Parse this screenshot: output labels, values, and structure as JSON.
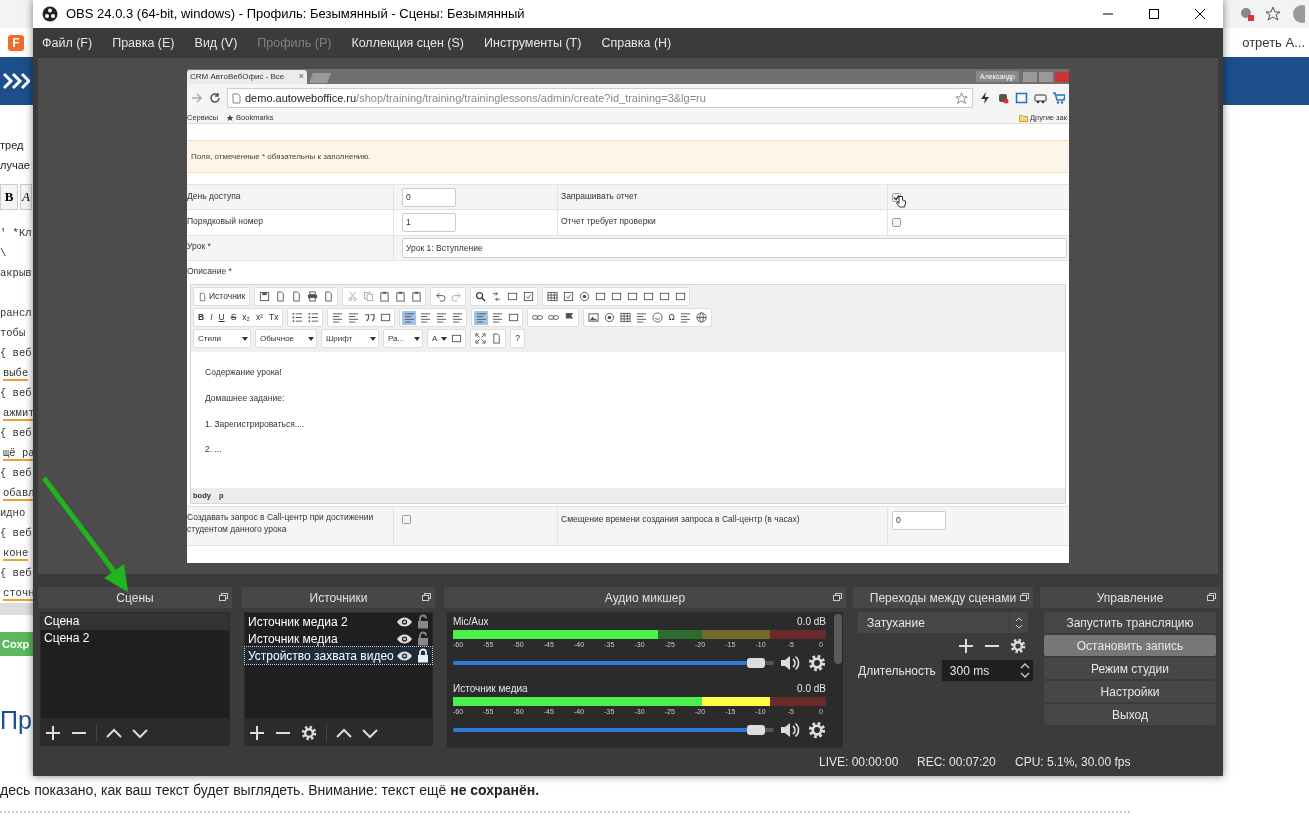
{
  "background_page": {
    "favicon_letter": "F",
    "bookmark_text": "отреть А...",
    "left_lines": [
      {
        "kind": "text",
        "text": "тред"
      },
      {
        "kind": "text",
        "text": "лучае"
      },
      {
        "kind": "toolbar",
        "buttons": [
          "B",
          "A"
        ]
      },
      {
        "kind": "code",
        "text": "' *Кл",
        "underlined": false
      },
      {
        "kind": "code",
        "text": "\\",
        "underlined": false
      },
      {
        "kind": "code",
        "text": "акрыв",
        "underlined": false
      },
      {
        "kind": "blank"
      },
      {
        "kind": "code",
        "text": "рансл",
        "underlined": false
      },
      {
        "kind": "code",
        "text": "тобы",
        "underlined": false
      },
      {
        "kind": "code",
        "text": "{ веб",
        "underlined": false
      },
      {
        "kind": "code",
        "text": "выбе",
        "underlined": true
      },
      {
        "kind": "code",
        "text": "{ веб",
        "underlined": false
      },
      {
        "kind": "code",
        "text": "ажмит",
        "underlined": true
      },
      {
        "kind": "code",
        "text": "{ веб",
        "underlined": false
      },
      {
        "kind": "code",
        "text": "щё ра",
        "underlined": true
      },
      {
        "kind": "code",
        "text": "{ веб",
        "underlined": false
      },
      {
        "kind": "code",
        "text": "обавл",
        "underlined": true
      },
      {
        "kind": "code",
        "text": "идно",
        "underlined": false
      },
      {
        "kind": "code",
        "text": "{ веб",
        "underlined": false
      },
      {
        "kind": "code",
        "text": "коне",
        "underlined": true
      },
      {
        "kind": "code",
        "text": "{ веб",
        "underlined": false
      },
      {
        "kind": "code",
        "text": "сточн",
        "underlined": true
      }
    ],
    "save_button": "Сохр",
    "heading": "Пр",
    "preview_note": "десь показано, как ваш текст будет выглядеть. Внимание: текст ещё **не сохранён.**"
  },
  "window": {
    "title": "OBS 24.0.3 (64-bit, windows) - Профиль: Безымянный - Сцены: Безымянный"
  },
  "menu": [
    {
      "label": "Файл (F)",
      "disabled": false
    },
    {
      "label": "Правка (E)",
      "disabled": false
    },
    {
      "label": "Вид (V)",
      "disabled": false
    },
    {
      "label": "Профиль (P)",
      "disabled": true
    },
    {
      "label": "Коллекция сцен (S)",
      "disabled": false
    },
    {
      "label": "Инструменты (T)",
      "disabled": false
    },
    {
      "label": "Справка (H)",
      "disabled": false
    }
  ],
  "captured_browser": {
    "tab_title": "CRM АвтоВебОфис - Все",
    "tab_close": "×",
    "user": "Александр",
    "url_host": "demo.autoweboffice.ru",
    "url_path": "/shop/training/training/traininglessons/admin/create?id_training=3&lg=ru",
    "bookmarks": [
      "Сервисы",
      "Bookmarks"
    ],
    "other_bookmarks": "Другие зак",
    "notice": "Поля, отмеченные * обязательны к заполнению.",
    "form_rows": [
      {
        "label": "День доступа",
        "value": "0",
        "option_label": "Запрашивать отчет",
        "checked": true
      },
      {
        "label": "Порядковый номер",
        "value": "1",
        "option_label": "Отчет требует проверки",
        "checked": false
      }
    ],
    "lesson": {
      "label": "Урок *",
      "value": "Урок 1: Вступление"
    },
    "description_label": "Описание *",
    "editor": {
      "toolbar_rows": [
        [
          [
            {
              "kind": "button",
              "label": "Источник",
              "active": false
            }
          ],
          [
            {
              "kind": "icon",
              "active": false
            },
            {
              "kind": "icon",
              "active": false
            },
            {
              "kind": "icon",
              "active": false
            },
            {
              "kind": "icon",
              "active": false
            },
            {
              "kind": "icon",
              "active": false
            }
          ],
          [
            {
              "kind": "icon",
              "active": false
            },
            {
              "kind": "icon",
              "active": false
            },
            {
              "kind": "icon",
              "active": false
            },
            {
              "kind": "icon",
              "active": false
            },
            {
              "kind": "icon",
              "active": false
            }
          ],
          [
            {
              "kind": "icon",
              "active": false
            },
            {
              "kind": "icon",
              "active": false
            }
          ],
          [
            {
              "kind": "icon",
              "active": false
            },
            {
              "kind": "icon",
              "active": false
            },
            {
              "kind": "icon",
              "active": false
            },
            {
              "kind": "icon",
              "active": false
            }
          ],
          [
            {
              "kind": "icon",
              "active": false
            },
            {
              "kind": "icon",
              "active": false
            },
            {
              "kind": "icon",
              "active": false
            },
            {
              "kind": "icon",
              "active": false
            },
            {
              "kind": "icon",
              "active": false
            },
            {
              "kind": "icon",
              "active": false
            },
            {
              "kind": "icon",
              "active": false
            },
            {
              "kind": "icon",
              "active": false
            },
            {
              "kind": "icon",
              "active": false
            }
          ]
        ],
        [
          [
            {
              "kind": "button",
              "label": "B",
              "active": false
            },
            {
              "kind": "button",
              "label": "I",
              "active": false
            },
            {
              "kind": "button",
              "label": "U",
              "active": false
            },
            {
              "kind": "button",
              "label": "S",
              "active": false
            },
            {
              "kind": "button",
              "label": "x₂",
              "active": false
            },
            {
              "kind": "button",
              "label": "x²",
              "active": false
            },
            {
              "kind": "button",
              "label": "Tx",
              "active": false
            }
          ],
          [
            {
              "kind": "icon",
              "active": false
            },
            {
              "kind": "icon",
              "active": false
            }
          ],
          [
            {
              "kind": "icon",
              "active": false
            },
            {
              "kind": "icon",
              "active": false
            },
            {
              "kind": "icon",
              "active": false
            },
            {
              "kind": "icon",
              "active": false
            }
          ],
          [
            {
              "kind": "icon",
              "active": true
            },
            {
              "kind": "icon",
              "active": false
            },
            {
              "kind": "icon",
              "active": false
            },
            {
              "kind": "icon",
              "active": false
            }
          ],
          [
            {
              "kind": "icon",
              "active": true
            },
            {
              "kind": "icon",
              "active": false
            },
            {
              "kind": "icon",
              "active": false
            }
          ],
          [
            {
              "kind": "icon",
              "active": false
            },
            {
              "kind": "icon",
              "active": false
            },
            {
              "kind": "icon",
              "active": false
            }
          ],
          [
            {
              "kind": "icon",
              "active": false
            },
            {
              "kind": "icon",
              "active": false
            },
            {
              "kind": "icon",
              "active": false
            },
            {
              "kind": "icon",
              "active": false
            },
            {
              "kind": "icon",
              "active": false
            },
            {
              "kind": "button",
              "label": "Ω",
              "active": false
            },
            {
              "kind": "icon",
              "active": false
            },
            {
              "kind": "icon",
              "active": false
            }
          ]
        ],
        [
          [
            {
              "kind": "dropdown",
              "label": "Стили"
            }
          ],
          [
            {
              "kind": "dropdown",
              "label": "Обычное"
            }
          ],
          [
            {
              "kind": "dropdown",
              "label": "Шрифт"
            }
          ],
          [
            {
              "kind": "dropdown",
              "label": "Ра..."
            }
          ],
          [
            {
              "kind": "dropdown",
              "label": "A"
            },
            {
              "kind": "icon",
              "active": false
            }
          ],
          [
            {
              "kind": "icon",
              "active": false
            },
            {
              "kind": "icon",
              "active": false
            }
          ],
          [
            {
              "kind": "button",
              "label": "?",
              "active": false
            }
          ]
        ]
      ],
      "content": [
        "Содержание урока!",
        "Домашнее задание:",
        "1. Зарегистрироваться....",
        "2. ..."
      ],
      "path": [
        "body",
        "p"
      ]
    },
    "callcenter_row": {
      "label": "Создавать запрос в Call-центр при достижении студентом данного урока",
      "checked": false,
      "option_label": "Смещение времени создания запроса в Call-центр (в часах)",
      "value": "0"
    }
  },
  "scenes": {
    "title": "Сцены",
    "items": [
      {
        "label": "Сцена",
        "selected": true
      },
      {
        "label": "Сцена 2",
        "selected": false
      }
    ]
  },
  "sources": {
    "title": "Источники",
    "items": [
      {
        "label": "Источник медиа 2",
        "visible": true,
        "locked": false,
        "selected": false
      },
      {
        "label": "Источник медиа",
        "visible": true,
        "locked": false,
        "selected": false
      },
      {
        "label": "Устройство захвата видео",
        "visible": true,
        "locked": true,
        "selected": true
      }
    ]
  },
  "mixer": {
    "title": "Аудио микшер",
    "channels": [
      {
        "name": "Mic/Aux",
        "reading": "0.0 dB",
        "meter": {
          "level": 0.55
        },
        "volume": {
          "level": 0.97
        },
        "scale": [
          "-60",
          "-55",
          "-50",
          "-45",
          "-40",
          "-35",
          "-30",
          "-25",
          "-20",
          "-15",
          "-10",
          "-5",
          "0"
        ]
      },
      {
        "name": "Источник медиа",
        "reading": "0.0 dB",
        "meter": {
          "level": 0.85
        },
        "volume": {
          "level": 0.97
        },
        "scale": [
          "-60",
          "-55",
          "-50",
          "-45",
          "-40",
          "-35",
          "-30",
          "-25",
          "-20",
          "-15",
          "-10",
          "-5",
          "0"
        ]
      }
    ]
  },
  "transitions": {
    "title": "Переходы между сценами",
    "transition": "Затухание",
    "duration_label": "Длительность",
    "duration": "300 ms"
  },
  "controls": {
    "title": "Управление",
    "buttons": [
      {
        "label": "Запустить трансляцию",
        "active": false
      },
      {
        "label": "Остановить запись",
        "active": true
      },
      {
        "label": "Режим студии",
        "active": false
      },
      {
        "label": "Настройки",
        "active": false
      },
      {
        "label": "Выход",
        "active": false
      }
    ]
  },
  "status_bar": {
    "live": "LIVE: 00:00:00",
    "rec": "REC: 00:07:20",
    "cpu": "CPU: 5.1%, 30.00 fps"
  }
}
